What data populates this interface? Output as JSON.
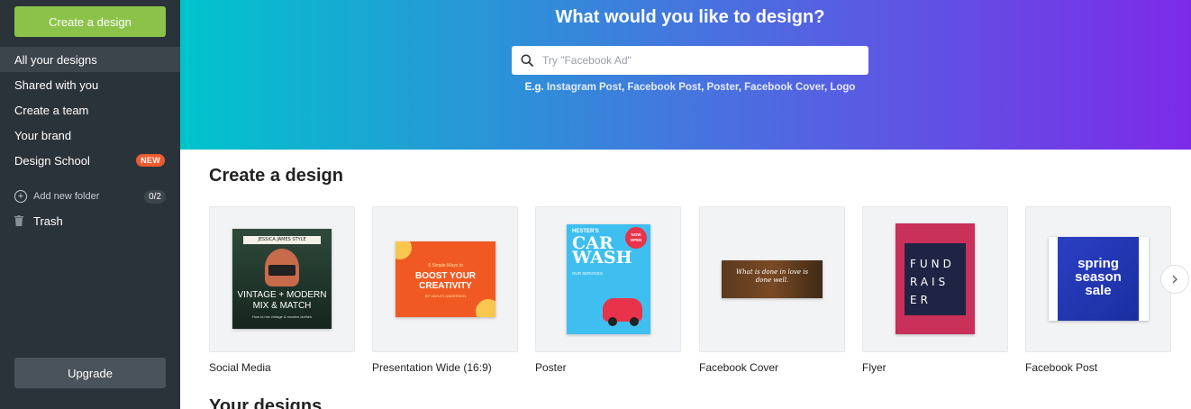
{
  "sidebar": {
    "create_label": "Create a design",
    "nav": [
      {
        "label": "All your designs"
      },
      {
        "label": "Shared with you"
      },
      {
        "label": "Create a team"
      },
      {
        "label": "Your brand"
      },
      {
        "label": "Design School",
        "badge": "NEW"
      }
    ],
    "add_folder_label": "Add new folder",
    "folder_count": "0/2",
    "trash_label": "Trash",
    "upgrade_label": "Upgrade"
  },
  "hero": {
    "title": "What would you like to design?",
    "search_placeholder": "Try \"Facebook Ad\"",
    "examples_prefix": "E.g.",
    "examples": [
      "Instagram Post",
      "Facebook Post",
      "Poster",
      "Facebook Cover",
      "Logo"
    ]
  },
  "main": {
    "section_title": "Create a design",
    "next_section_title": "Your designs",
    "cards": [
      {
        "label": "Social Media",
        "thumb": {
          "header": "JESSICA JAMES STYLE",
          "title": "VINTAGE + MODERN MIX & MATCH",
          "sub": "How to mix vintage & modern clothes"
        }
      },
      {
        "label": "Presentation Wide (16:9)",
        "thumb": {
          "kicker": "5 Simple Ways to",
          "title": "BOOST YOUR CREATIVITY",
          "sub": "BY HAYLEY ANDERSON"
        }
      },
      {
        "label": "Poster",
        "thumb": {
          "kicker": "HESTER'S",
          "title1": "CAR",
          "title2": "WASH",
          "badge": "NOW OPEN",
          "sub": "OUR SERVICES"
        }
      },
      {
        "label": "Facebook Cover",
        "thumb": {
          "quote": "What is done in love is done well."
        }
      },
      {
        "label": "Flyer",
        "thumb": {
          "line1": "FUND",
          "line2": "RAIS",
          "line3": "ER"
        }
      },
      {
        "label": "Facebook Post",
        "thumb": {
          "title": "spring season sale"
        }
      }
    ]
  },
  "colors": {
    "sidebar_bg": "#2b333a",
    "create_green": "#8bc34a",
    "new_badge": "#ef5a2f",
    "hero_start": "#00c4cc",
    "hero_end": "#7d2ae8"
  }
}
